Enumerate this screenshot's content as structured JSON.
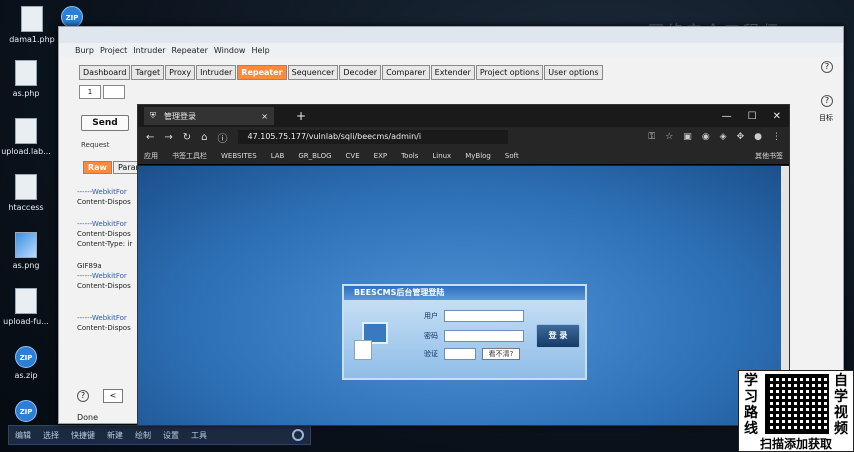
{
  "desktop": {
    "icons": [
      {
        "label": "dama1.php"
      },
      {
        "label": "as.php"
      },
      {
        "label": "upload.lab..."
      },
      {
        "label": "htaccess"
      },
      {
        "label": "as.png"
      },
      {
        "label": "upload-fu..."
      },
      {
        "label": "as.zip"
      },
      {
        "label": ""
      }
    ],
    "taskbar_items": [
      "编辑",
      "选择",
      "快捷键",
      "新建",
      "绘制",
      "设置",
      "工具"
    ]
  },
  "burp": {
    "menu": [
      "Burp",
      "Project",
      "Intruder",
      "Repeater",
      "Window",
      "Help"
    ],
    "tabs": [
      "Dashboard",
      "Target",
      "Proxy",
      "Intruder",
      "Repeater",
      "Sequencer",
      "Decoder",
      "Comparer",
      "Extender",
      "Project options",
      "User options"
    ],
    "active_tab": "Repeater",
    "subtab_label": "1",
    "send_label": "Send",
    "request_label": "Request",
    "raw_tabs": [
      "Raw",
      "Params"
    ],
    "request_lines": [
      "------WebkitFor",
      "Content-Dispos",
      "------WebkitFor",
      "Content-Dispos",
      "Content-Type: ir",
      "GIF89a",
      "------WebkitFor",
      "Content-Dispos",
      "------WebkitFor",
      "Content-Dispos"
    ],
    "done_label": "Done",
    "help_label": "?",
    "prev_label": "<",
    "right_label": "目标"
  },
  "browser": {
    "tab_title": "管理登录",
    "url": "47.105.75.177/vulnlab/sqli/beecms/admin/i",
    "bookmarks": [
      "应用",
      "书签工具栏",
      "WEBSITES",
      "LAB",
      "GR_BLOG",
      "CVE",
      "EXP",
      "Tools",
      "Linux",
      "MyBlog",
      "Soft"
    ],
    "other_bookmarks": "其他书签"
  },
  "login": {
    "title": "BEESCMS后台管理登陆",
    "user_label": "用户",
    "pass_label": "密码",
    "code_label": "验证",
    "captcha_text": "看不清?",
    "login_button": "登 录"
  },
  "promo": {
    "left": "学习路线",
    "right": "自学视频",
    "bottom": "扫描添加获取"
  },
  "watermark": "网络安全工程师"
}
